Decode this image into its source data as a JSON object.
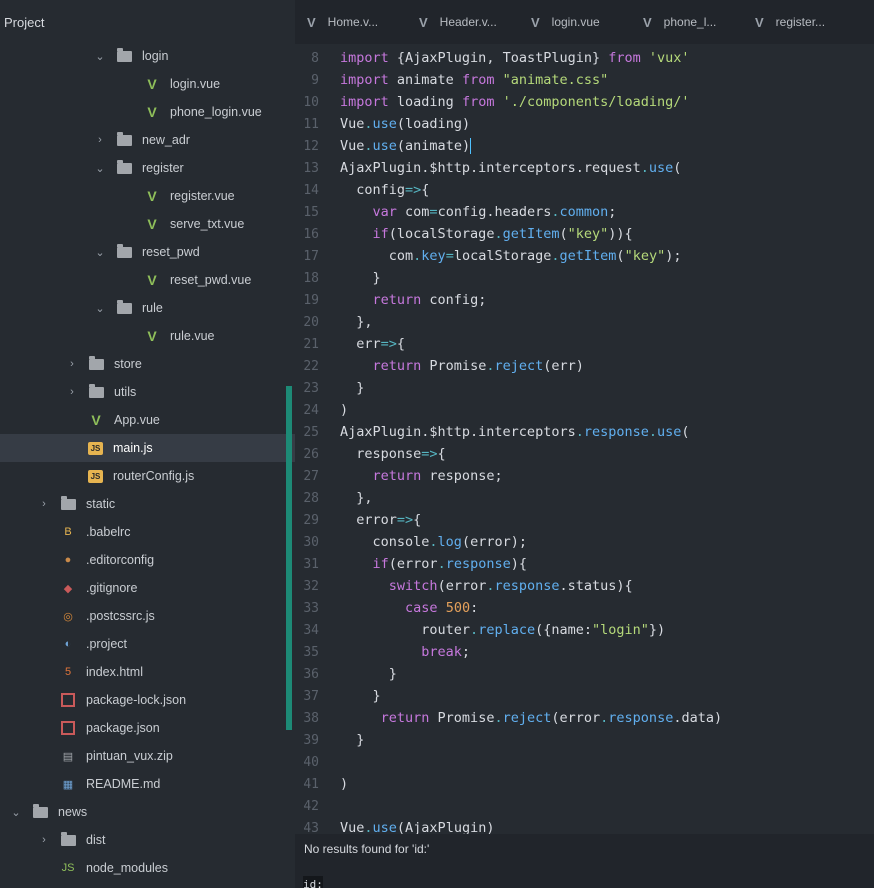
{
  "sidebar": {
    "title": "Project",
    "items": [
      {
        "label": "login",
        "type": "folder",
        "expanded": true,
        "depth": 3
      },
      {
        "label": "login.vue",
        "type": "vue",
        "depth": 4
      },
      {
        "label": "phone_login.vue",
        "type": "vue",
        "depth": 4
      },
      {
        "label": "new_adr",
        "type": "folder",
        "expanded": false,
        "depth": 3
      },
      {
        "label": "register",
        "type": "folder",
        "expanded": true,
        "depth": 3
      },
      {
        "label": "register.vue",
        "type": "vue",
        "depth": 4
      },
      {
        "label": "serve_txt.vue",
        "type": "vue",
        "depth": 4
      },
      {
        "label": "reset_pwd",
        "type": "folder",
        "expanded": true,
        "depth": 3
      },
      {
        "label": "reset_pwd.vue",
        "type": "vue",
        "depth": 4
      },
      {
        "label": "rule",
        "type": "folder",
        "expanded": true,
        "depth": 3
      },
      {
        "label": "rule.vue",
        "type": "vue",
        "depth": 4
      },
      {
        "label": "store",
        "type": "folder",
        "expanded": false,
        "depth": 2
      },
      {
        "label": "utils",
        "type": "folder",
        "expanded": false,
        "depth": 2
      },
      {
        "label": "App.vue",
        "type": "vue",
        "depth": 2
      },
      {
        "label": "main.js",
        "type": "js",
        "depth": 2,
        "selected": true
      },
      {
        "label": "routerConfig.js",
        "type": "js",
        "depth": 2
      },
      {
        "label": "static",
        "type": "folder",
        "expanded": false,
        "depth": 1
      },
      {
        "label": ".babelrc",
        "type": "babel",
        "depth": 1
      },
      {
        "label": ".editorconfig",
        "type": "editorconfig",
        "depth": 1
      },
      {
        "label": ".gitignore",
        "type": "git",
        "depth": 1
      },
      {
        "label": ".postcssrc.js",
        "type": "postcss",
        "depth": 1
      },
      {
        "label": ".project",
        "type": "project",
        "depth": 1
      },
      {
        "label": "index.html",
        "type": "html",
        "depth": 1
      },
      {
        "label": "package-lock.json",
        "type": "json",
        "depth": 1
      },
      {
        "label": "package.json",
        "type": "json",
        "depth": 1
      },
      {
        "label": "pintuan_vux.zip",
        "type": "zip",
        "depth": 1
      },
      {
        "label": "README.md",
        "type": "md",
        "depth": 1
      },
      {
        "label": "news",
        "type": "folder",
        "expanded": true,
        "depth": 0
      },
      {
        "label": "dist",
        "type": "folder",
        "expanded": false,
        "depth": 1
      },
      {
        "label": "node_modules",
        "type": "nodemodules",
        "expanded": false,
        "depth": 1
      }
    ]
  },
  "tabs": [
    {
      "label": "Home.v..."
    },
    {
      "label": "Header.v..."
    },
    {
      "label": "login.vue"
    },
    {
      "label": "phone_l..."
    },
    {
      "label": "register..."
    }
  ],
  "editor": {
    "lines": [
      {
        "n": "8",
        "text": "import {AjaxPlugin, ToastPlugin} from 'vux'"
      },
      {
        "n": "9",
        "text": "import animate from \"animate.css\""
      },
      {
        "n": "10",
        "text": "import loading from './components/loading/'"
      },
      {
        "n": "11",
        "text": "Vue.use(loading)"
      },
      {
        "n": "12",
        "text": "Vue.use(animate)",
        "cursor": true
      },
      {
        "n": "13",
        "text": "AjaxPlugin.$http.interceptors.request.use("
      },
      {
        "n": "14",
        "text": "  config=>{"
      },
      {
        "n": "15",
        "text": "    var com=config.headers.common;"
      },
      {
        "n": "16",
        "text": "    if(localStorage.getItem(\"key\")){"
      },
      {
        "n": "17",
        "text": "      com.key=localStorage.getItem(\"key\");"
      },
      {
        "n": "18",
        "text": "    }"
      },
      {
        "n": "19",
        "text": "    return config;"
      },
      {
        "n": "20",
        "text": "  },"
      },
      {
        "n": "21",
        "text": "  err=>{"
      },
      {
        "n": "22",
        "text": "    return Promise.reject(err)"
      },
      {
        "n": "23",
        "text": "  }"
      },
      {
        "n": "24",
        "text": ")"
      },
      {
        "n": "25",
        "text": "AjaxPlugin.$http.interceptors.response.use("
      },
      {
        "n": "26",
        "text": "  response=>{"
      },
      {
        "n": "27",
        "text": "    return response;"
      },
      {
        "n": "28",
        "text": "  },"
      },
      {
        "n": "29",
        "text": "  error=>{"
      },
      {
        "n": "30",
        "text": "    console.log(error);"
      },
      {
        "n": "31",
        "text": "    if(error.response){"
      },
      {
        "n": "32",
        "text": "      switch(error.response.status){"
      },
      {
        "n": "33",
        "text": "        case 500:"
      },
      {
        "n": "34",
        "text": "          router.replace({name:\"login\"})"
      },
      {
        "n": "35",
        "text": "          break;"
      },
      {
        "n": "36",
        "text": "      }"
      },
      {
        "n": "37",
        "text": "    }"
      },
      {
        "n": "38",
        "text": "     return Promise.reject(error.response.data)"
      },
      {
        "n": "39",
        "text": "  }"
      },
      {
        "n": "40",
        "text": ""
      },
      {
        "n": "41",
        "text": ")"
      },
      {
        "n": "42",
        "text": ""
      },
      {
        "n": "43",
        "text": "Vue.use(AjaxPlugin)"
      }
    ]
  },
  "find": {
    "message": "No results found for 'id:'",
    "query": "id:"
  },
  "colors": {
    "background": "#262b31",
    "tabbar": "#21252b",
    "git_modified": "#1d8a76",
    "cursor": "#4fc1ff"
  }
}
